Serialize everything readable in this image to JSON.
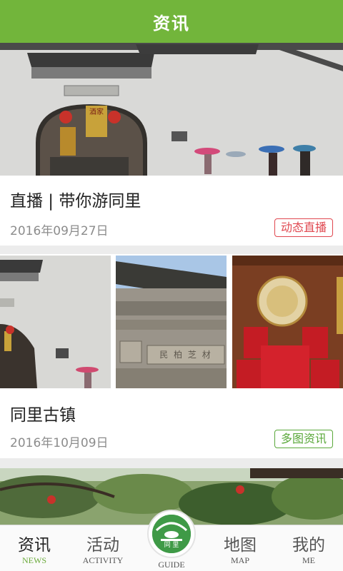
{
  "header": {
    "title": "资讯"
  },
  "articles": [
    {
      "title": "直播 | 带你游同里",
      "date": "2016年09月27日",
      "tag": "动态直播"
    },
    {
      "title": "同里古镇",
      "date": "2016年10月09日",
      "tag": "多图资讯"
    }
  ],
  "lantern_signs": [
    "酒家",
    "同里"
  ],
  "plaque_text": "民 柏 芝 材",
  "logo_text": "同 里",
  "tabs": [
    {
      "label": "资讯",
      "sub": "NEWS",
      "icon": "news-icon"
    },
    {
      "label": "活动",
      "sub": "ACTIVITY",
      "icon": "activity-icon"
    },
    {
      "label": "",
      "sub": "GUIDE",
      "icon": "guide-logo-icon"
    },
    {
      "label": "地图",
      "sub": "MAP",
      "icon": "map-icon"
    },
    {
      "label": "我的",
      "sub": "ME",
      "icon": "me-icon"
    }
  ],
  "colors": {
    "primary": "#72b53b",
    "live_tag": "#e0474f",
    "multi_tag": "#5aa83a",
    "guide": "#3f9a47"
  }
}
